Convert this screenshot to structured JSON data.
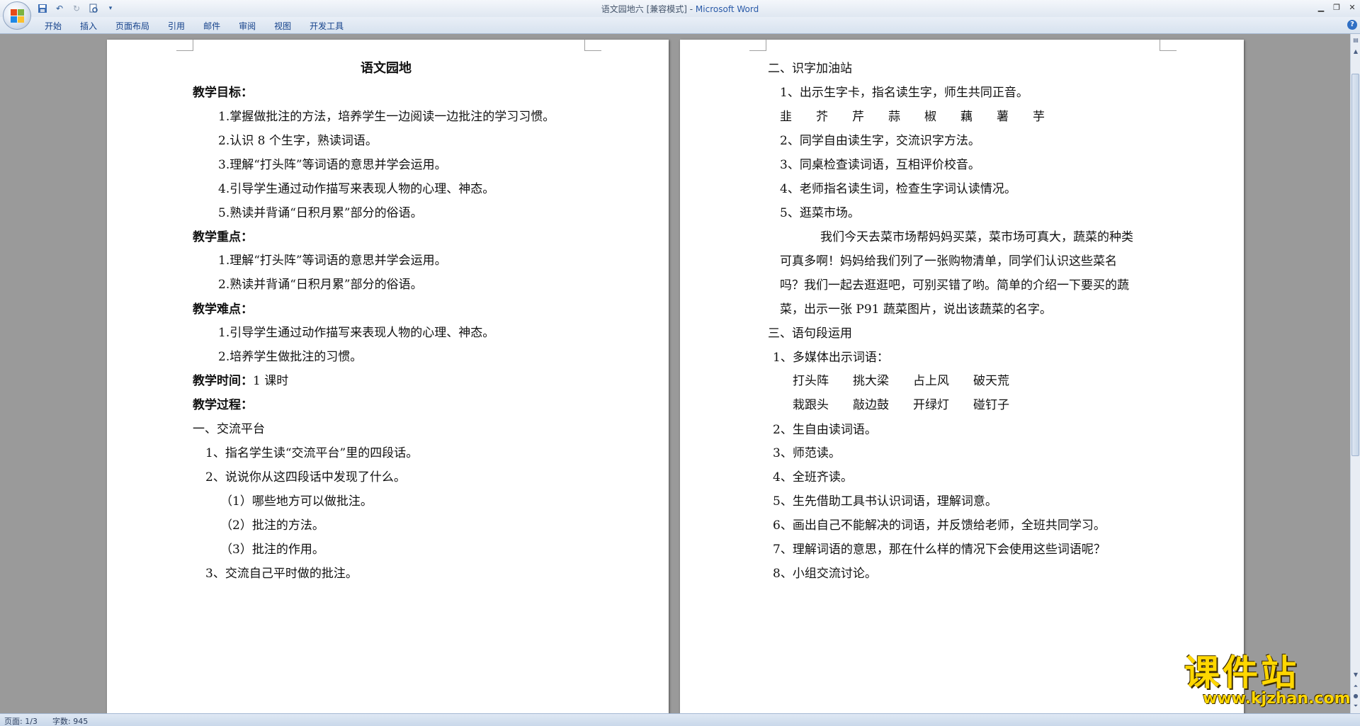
{
  "window": {
    "title": "语文园地六 [兼容模式] - ",
    "app_name": "Microsoft Word"
  },
  "quick_access": [
    "save-icon",
    "undo-icon",
    "redo-icon",
    "print-preview-icon",
    "customize-icon"
  ],
  "ribbon": {
    "tabs": [
      "开始",
      "插入",
      "页面布局",
      "引用",
      "邮件",
      "审阅",
      "视图",
      "开发工具"
    ]
  },
  "page1": {
    "title": "语文园地",
    "lines": [
      {
        "text": "教学目标：",
        "bold": true
      },
      {
        "text": "1.掌握做批注的方法，培养学生一边阅读一边批注的学习习惯。"
      },
      {
        "text": "2.认识 8 个生字，熟读词语。"
      },
      {
        "text": "3.理解“打头阵”等词语的意思并学会运用。"
      },
      {
        "text": "4.引导学生通过动作描写来表现人物的心理、神态。"
      },
      {
        "text": "5.熟读并背诵“日积月累”部分的俗语。"
      },
      {
        "text": "教学重点：",
        "bold": true
      },
      {
        "text": "1.理解“打头阵”等词语的意思并学会运用。"
      },
      {
        "text": "2.熟读并背诵“日积月累”部分的俗语。"
      },
      {
        "text": "教学难点：",
        "bold": true
      },
      {
        "text": "1.引导学生通过动作描写来表现人物的心理、神态。"
      },
      {
        "text": "2.培养学生做批注的习惯。"
      },
      {
        "text": "教学时间：",
        "bold": true,
        "suffix": "1 课时"
      },
      {
        "text": "教学过程：",
        "bold": true
      },
      {
        "text": "一、交流平台"
      },
      {
        "text": "1、指名学生读“交流平台”里的四段话。"
      },
      {
        "text": "2、说说你从这四段话中发现了什么。"
      },
      {
        "text": "（1）哪些地方可以做批注。"
      },
      {
        "text": "（2）批注的方法。"
      },
      {
        "text": "（3）批注的作用。"
      },
      {
        "text": "3、交流自己平时做的批注。"
      }
    ]
  },
  "page2": {
    "lines": [
      {
        "text": "二、识字加油站"
      },
      {
        "text": "1、出示生字卡，指名读生字，师生共同正音。"
      },
      {
        "text": "韭　　芥　　芹　　蒜　　椒　　藕　　薯　　芋"
      },
      {
        "text": "2、同学自由读生字，交流识字方法。"
      },
      {
        "text": "3、同桌检查读词语，互相评价校音。"
      },
      {
        "text": "4、老师指名读生词，检查生字词认读情况。"
      },
      {
        "text": "5、逛菜市场。"
      },
      {
        "text": "我们今天去菜市场帮妈妈买菜，菜市场可真大，蔬菜的种类"
      },
      {
        "text": "可真多啊！妈妈给我们列了一张购物清单，同学们认识这些菜名"
      },
      {
        "text": "吗？我们一起去逛逛吧，可别买错了哟。简单的介绍一下要买的蔬"
      },
      {
        "text": "菜，出示一张 P91 蔬菜图片，说出该蔬菜的名字。"
      },
      {
        "text": "三、语句段运用"
      },
      {
        "text": "1、多媒体出示词语："
      },
      {
        "text": "打头阵　　挑大梁　　占上风　　破天荒"
      },
      {
        "text": "栽跟头　　敲边鼓　　开绿灯　　碰钉子"
      },
      {
        "text": "2、生自由读词语。"
      },
      {
        "text": "3、师范读。"
      },
      {
        "text": "4、全班齐读。"
      },
      {
        "text": "5、生先借助工具书认识词语，理解词意。"
      },
      {
        "text": "6、画出自己不能解决的词语，并反馈给老师，全班共同学习。"
      },
      {
        "text": "7、理解词语的意思，那在什么样的情况下会使用这些词语呢？"
      },
      {
        "text": "8、小组交流讨论。"
      }
    ]
  },
  "statusbar": {
    "page": "页面: 1/3",
    "words": "字数: 945"
  },
  "watermark": {
    "cn": "课件站",
    "en": "www.kjzhan.com"
  }
}
